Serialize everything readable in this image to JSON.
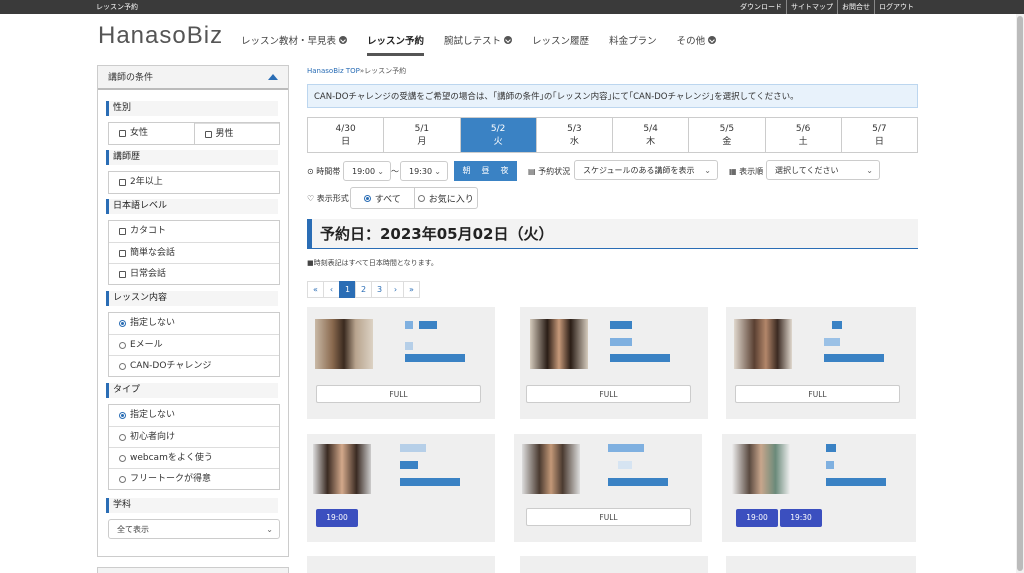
{
  "topbar": {
    "left": "レッスン予約",
    "links": [
      "ダウンロード",
      "サイトマップ",
      "お問合せ",
      "ログアウト"
    ]
  },
  "logo": "HanasoBiz",
  "nav": {
    "items": [
      "レッスン教材・早見表",
      "レッスン予約",
      "腕試しテスト",
      "レッスン履歴",
      "料金プラン",
      "その他"
    ]
  },
  "sidebar": {
    "header": "講師の条件",
    "gender": {
      "title": "性別",
      "options": [
        "女性",
        "男性"
      ]
    },
    "career": {
      "title": "講師歴",
      "options": [
        "2年以上"
      ]
    },
    "japanese": {
      "title": "日本語レベル",
      "options": [
        "カタコト",
        "簡単な会話",
        "日常会話"
      ]
    },
    "lesson": {
      "title": "レッスン内容",
      "options": [
        "指定しない",
        "Eメール",
        "CAN-DOチャレンジ"
      ]
    },
    "type": {
      "title": "タイプ",
      "options": [
        "指定しない",
        "初心者向け",
        "webcamをよく使う",
        "フリートークが得意"
      ]
    },
    "subject": {
      "title": "学科",
      "select": "全て表示"
    }
  },
  "breadcrumb": {
    "home": "HanasoBiz TOP",
    "sep": "»",
    "current": "レッスン予約"
  },
  "notice": "CAN-DOチャレンジの受講をご希望の場合は、｢講師の条件｣の｢レッスン内容｣にて｢CAN-DOチャレンジ｣を選択してください。",
  "days": [
    {
      "date": "4/30",
      "dow": "日"
    },
    {
      "date": "5/1",
      "dow": "月"
    },
    {
      "date": "5/2",
      "dow": "火"
    },
    {
      "date": "5/3",
      "dow": "水"
    },
    {
      "date": "5/4",
      "dow": "木"
    },
    {
      "date": "5/5",
      "dow": "金"
    },
    {
      "date": "5/6",
      "dow": "土"
    },
    {
      "date": "5/7",
      "dow": "日"
    }
  ],
  "filters": {
    "time_label": "時間帯",
    "time_from": "19:00",
    "tilde": "〜",
    "time_to": "19:30",
    "tod": [
      "朝",
      "昼",
      "夜"
    ],
    "status_label": "予約状況",
    "status_value": "スケジュールのある講師を表示",
    "order_label": "表示順",
    "order_value": "選択してください",
    "display_label": "表示形式",
    "display_all": "すべて",
    "display_fav": "お気に入り"
  },
  "date_heading": "予約日：2023年05月02日（火）",
  "tz_note": "■時刻表記はすべて日本時間となります。",
  "pager": [
    "«",
    "‹",
    "1",
    "2",
    "3",
    "›",
    "»"
  ],
  "cards": {
    "full_label": "FULL",
    "row2_left_slot": "19:00",
    "row2_right_slots": [
      "19:00",
      "19:30"
    ]
  },
  "colors": {
    "accent": "#2a6db5",
    "slot": "#3b4fbf"
  }
}
